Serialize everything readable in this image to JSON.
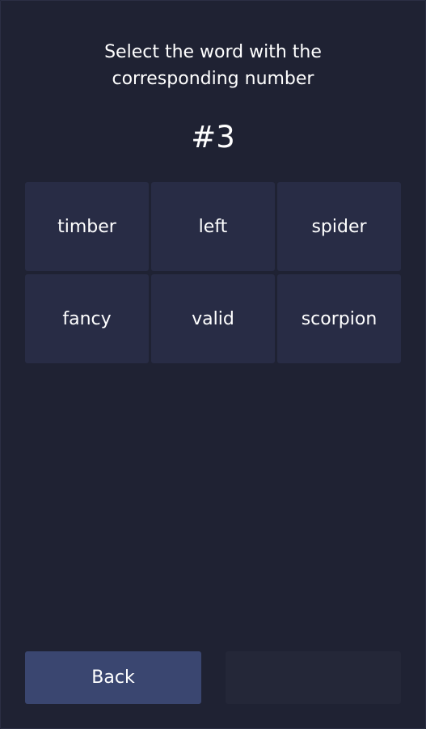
{
  "prompt": {
    "line1": "Select the word with the",
    "line2": "corresponding number"
  },
  "target_number": "#3",
  "words": [
    {
      "label": "timber"
    },
    {
      "label": "left"
    },
    {
      "label": "spider"
    },
    {
      "label": "fancy"
    },
    {
      "label": "valid"
    },
    {
      "label": "scorpion"
    }
  ],
  "footer": {
    "back_label": "Back",
    "next_label": ""
  }
}
